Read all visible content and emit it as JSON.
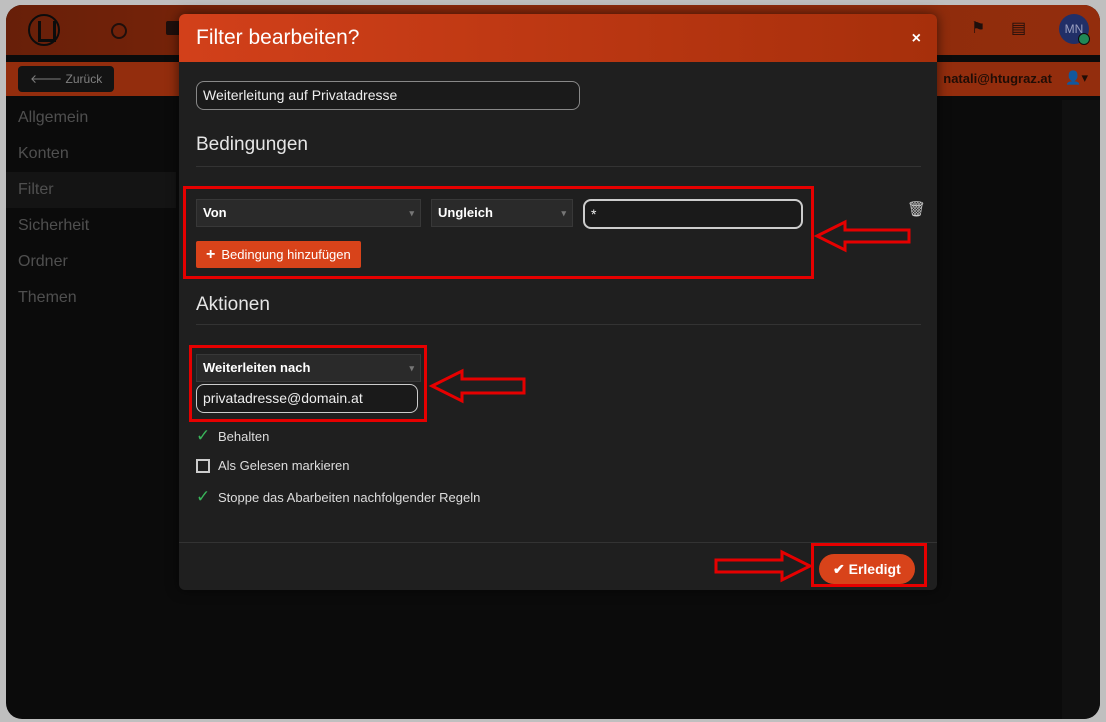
{
  "app": {
    "back_label": "Zurück",
    "user_email": "natali@htugraz.at",
    "avatar_initials": "MN",
    "colors": {
      "accent": "#d8431a",
      "header": "#c43d12",
      "check": "#39b45a",
      "annotation": "#e60000"
    }
  },
  "sidebar": {
    "items": [
      {
        "label": "Allgemein"
      },
      {
        "label": "Konten"
      },
      {
        "label": "Filter"
      },
      {
        "label": "Sicherheit"
      },
      {
        "label": "Ordner"
      },
      {
        "label": "Themen"
      }
    ],
    "active": "Filter"
  },
  "modal": {
    "title": "Filter bearbeiten?",
    "close_glyph": "×",
    "filter_name": "Weiterleitung auf Privatadresse",
    "conditions_heading": "Bedingungen",
    "condition": {
      "field": "Von",
      "operator": "Ungleich",
      "value": "*"
    },
    "add_condition_label": "Bedingung hinzufügen",
    "actions_heading": "Aktionen",
    "action": {
      "type": "Weiterleiten nach",
      "target": "privatadresse@domain.at"
    },
    "options": [
      {
        "label": "Behalten",
        "checked": true
      },
      {
        "label": "Als Gelesen markieren",
        "checked": false
      },
      {
        "label": "Stoppe das Abarbeiten nachfolgender Regeln",
        "checked": true
      }
    ],
    "done_label": "Erledigt"
  }
}
